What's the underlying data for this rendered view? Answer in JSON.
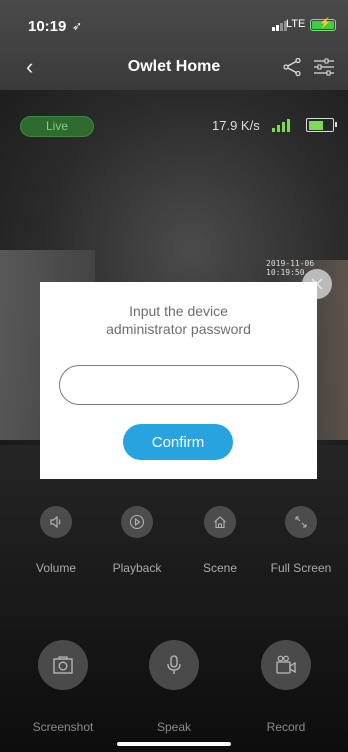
{
  "status_bar": {
    "time": "10:19",
    "location_glyph": "➶",
    "network": "LTE",
    "battery_color": "#3ecf3e"
  },
  "nav": {
    "title": "Owlet Home",
    "back_glyph": "‹"
  },
  "camera": {
    "live_label": "Live",
    "speed": "17.9 K/s",
    "timestamp": "2019-11-06 10:19:50",
    "accent_green": "#7ed957"
  },
  "dialog": {
    "message_line1": "Input the device",
    "message_line2": "administrator password",
    "password_value": "",
    "confirm_label": "Confirm",
    "confirm_color": "#27a3e0"
  },
  "controls": [
    {
      "label": "Volume",
      "icon": "volume-icon"
    },
    {
      "label": "Playback",
      "icon": "playback-icon"
    },
    {
      "label": "Scene",
      "icon": "home-scene-icon"
    },
    {
      "label": "Full Screen",
      "icon": "fullscreen-icon"
    }
  ],
  "actions": [
    {
      "label": "Screenshot",
      "icon": "screenshot-icon"
    },
    {
      "label": "Speak",
      "icon": "microphone-icon"
    },
    {
      "label": "Record",
      "icon": "record-video-icon"
    }
  ]
}
